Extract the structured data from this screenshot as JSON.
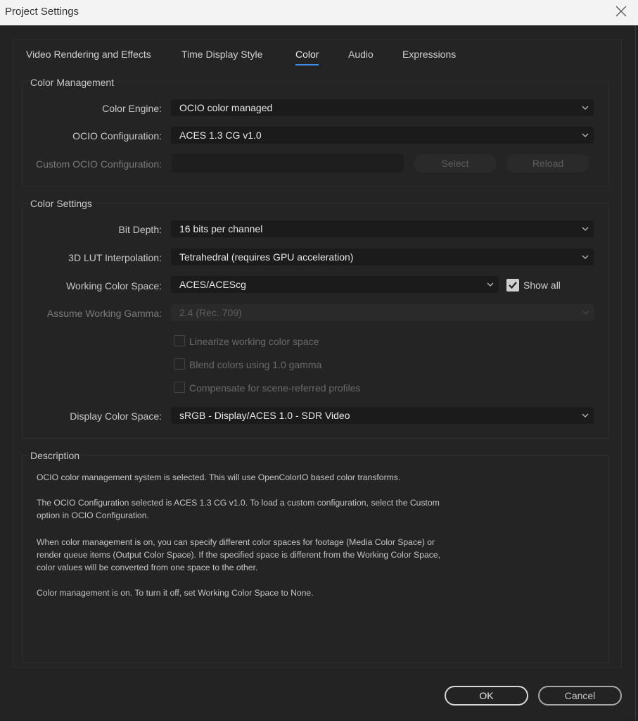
{
  "window": {
    "title": "Project Settings"
  },
  "tabs": [
    {
      "label": "Video Rendering and Effects",
      "active": false
    },
    {
      "label": "Time Display Style",
      "active": false
    },
    {
      "label": "Color",
      "active": true
    },
    {
      "label": "Audio",
      "active": false
    },
    {
      "label": "Expressions",
      "active": false
    }
  ],
  "color_management": {
    "title": "Color Management",
    "color_engine": {
      "label": "Color Engine:",
      "value": "OCIO color managed"
    },
    "ocio_configuration": {
      "label": "OCIO Configuration:",
      "value": "ACES 1.3 CG v1.0"
    },
    "custom_ocio": {
      "label": "Custom OCIO Configuration:",
      "value": "",
      "select_label": "Select",
      "reload_label": "Reload"
    }
  },
  "color_settings": {
    "title": "Color Settings",
    "bit_depth": {
      "label": "Bit Depth:",
      "value": "16 bits per channel"
    },
    "lut_interpolation": {
      "label": "3D LUT Interpolation:",
      "value": "Tetrahedral (requires GPU acceleration)"
    },
    "working_color_space": {
      "label": "Working Color Space:",
      "value": "ACES/ACEScg",
      "show_all_label": "Show all",
      "show_all_checked": true
    },
    "assume_working_gamma": {
      "label": "Assume Working Gamma:",
      "value": "2.4 (Rec. 709)",
      "disabled": true
    },
    "checkboxes": [
      {
        "label": "Linearize working color space",
        "checked": false,
        "disabled": true
      },
      {
        "label": "Blend colors using 1.0 gamma",
        "checked": false,
        "disabled": true
      },
      {
        "label": "Compensate for scene-referred profiles",
        "checked": false,
        "disabled": true
      }
    ],
    "display_color_space": {
      "label": "Display Color Space:",
      "value": "sRGB - Display/ACES 1.0 - SDR Video"
    }
  },
  "description": {
    "title": "Description",
    "lines": [
      "OCIO color management system is selected. This will use OpenColorIO based color transforms.",
      "The OCIO Configuration selected is ACES 1.3 CG v1.0. To load a custom configuration, select the Custom",
      "option in OCIO Configuration.",
      "When color management is on, you can specify different color spaces for footage (Media Color Space) or",
      "render queue items (Output Color Space). If the specified space is different from the Working Color Space,",
      "color values will be converted from one space to the other.",
      "Color management is on. To turn it off, set Working Color Space to None."
    ]
  },
  "footer": {
    "ok_label": "OK",
    "cancel_label": "Cancel"
  },
  "colors": {
    "accent": "#3d8ee8",
    "background": "#232323",
    "titlebar": "#f3f3f3"
  },
  "icons": {
    "close": "close-icon",
    "dropdown": "chevron-down-icon",
    "check": "checkmark-icon"
  }
}
